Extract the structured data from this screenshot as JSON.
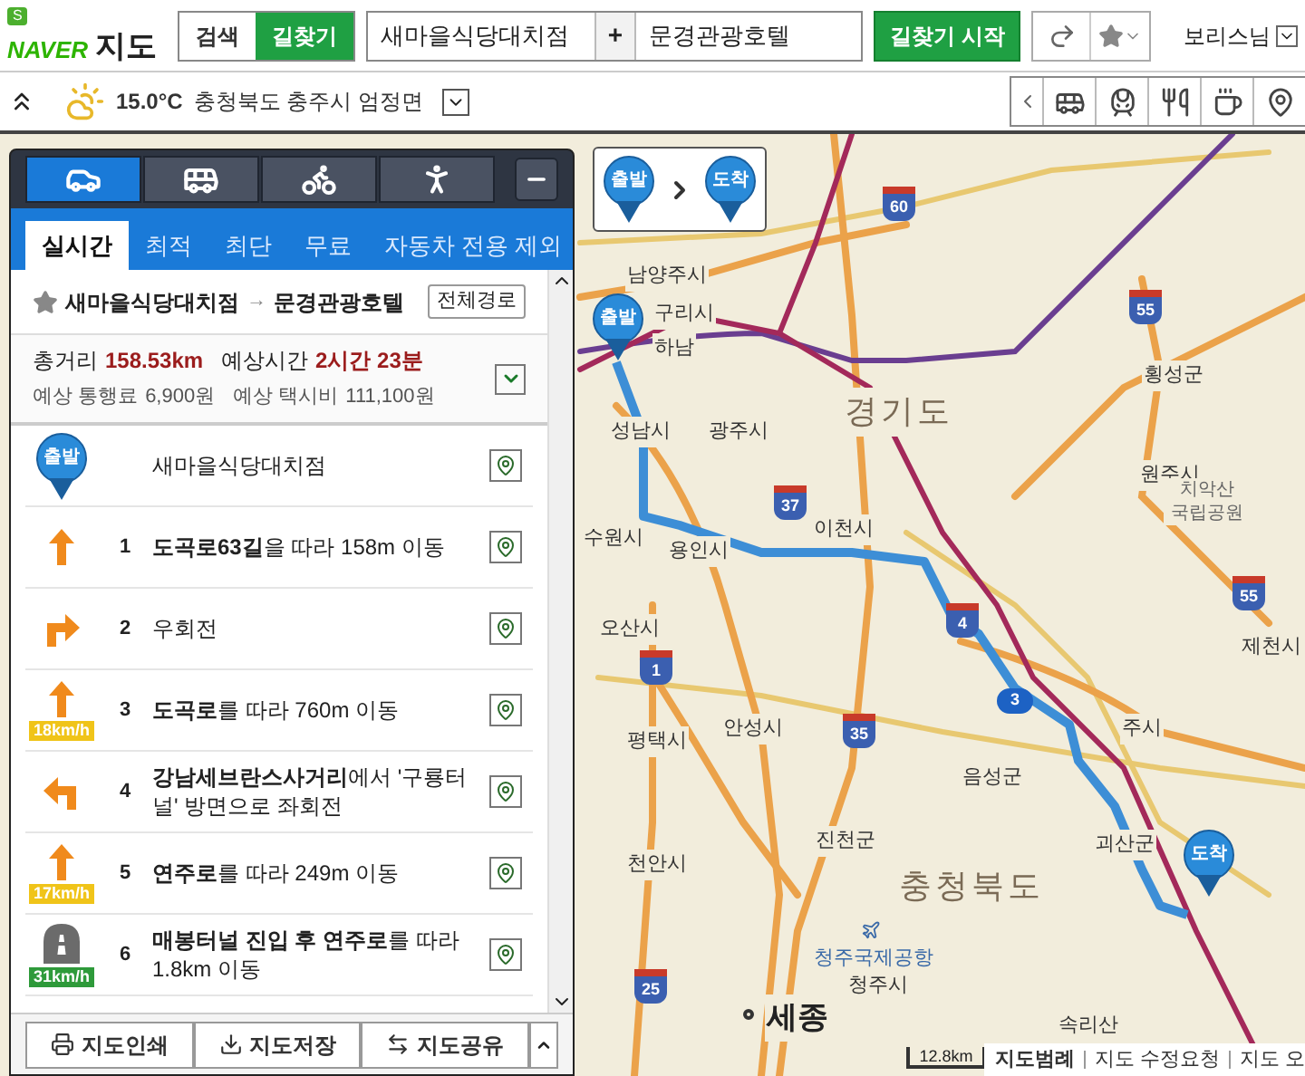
{
  "header": {
    "logo_badge": "S",
    "logo": "NAVER",
    "logo_suffix": "지도",
    "mode_buttons": [
      {
        "label": "검색",
        "selected": false
      },
      {
        "label": "길찾기",
        "selected": true
      }
    ],
    "origin": "새마을식당대치점",
    "add": "+",
    "destination": "문경관광호텔",
    "start_button": "길찾기 시작",
    "user": "보리스님"
  },
  "infobar": {
    "temperature": "15.0°C",
    "location": "충청북도 충주시 엄정면"
  },
  "panel": {
    "transport_tabs": [
      {
        "kind": "car",
        "selected": true
      },
      {
        "kind": "bus",
        "selected": false
      },
      {
        "kind": "bike",
        "selected": false
      },
      {
        "kind": "walk",
        "selected": false
      }
    ],
    "route_tabs": [
      {
        "label": "실시간",
        "selected": true
      },
      {
        "label": "최적",
        "selected": false
      },
      {
        "label": "최단",
        "selected": false
      },
      {
        "label": "무료",
        "selected": false
      },
      {
        "label": "자동차 전용 제외",
        "selected": false
      }
    ],
    "route_from": "새마을식당대치점",
    "route_arrow": "→",
    "route_to": "문경관광호텔",
    "full_route_button": "전체경로",
    "summary": {
      "distance_label": "총거리",
      "distance": "158.53km",
      "time_label": "예상시간",
      "time": "2시간 23분",
      "toll_label": "예상 통행료",
      "toll": "6,900원",
      "taxi_label": "예상 택시비",
      "taxi": "111,100원"
    },
    "steps": [
      {
        "kind": "start",
        "pin": "출발",
        "text": "새마을식당대치점"
      },
      {
        "kind": "straight",
        "number": "1",
        "text": "**도곡로63길**을 따라 158m 이동"
      },
      {
        "kind": "right",
        "number": "2",
        "text": "우회전"
      },
      {
        "kind": "straight",
        "number": "3",
        "text": "**도곡로**를 따라 760m 이동",
        "speed": "18km/h",
        "color": "#f0c419"
      },
      {
        "kind": "left",
        "number": "4",
        "text": "**강남세브란스사거리**에서 '구룡터널' 방면으로 좌회전"
      },
      {
        "kind": "straight",
        "number": "5",
        "text": "**연주로**를 따라 249m 이동",
        "speed": "17km/h",
        "color": "#f0c419"
      },
      {
        "kind": "tunnel",
        "number": "6",
        "text": "**매봉터널 진입 후 연주로**를 따라 1.8km 이동",
        "speed": "31km/h",
        "color": "#2e9a3a"
      }
    ],
    "footer_buttons": [
      {
        "kind": "print",
        "label": "지도인쇄"
      },
      {
        "kind": "save",
        "label": "지도저장"
      },
      {
        "kind": "share",
        "label": "지도공유"
      }
    ]
  },
  "map": {
    "legend": {
      "start": "출발",
      "end": "도착"
    },
    "start_pin": "출발",
    "end_pin": "도착",
    "labels": [
      {
        "text": "남양주시",
        "kind": "city"
      },
      {
        "text": "구리시",
        "kind": "city"
      },
      {
        "text": "하남",
        "kind": "city"
      },
      {
        "text": "성남시",
        "kind": "city"
      },
      {
        "text": "광주시",
        "kind": "city"
      },
      {
        "text": "경기도",
        "kind": "province"
      },
      {
        "text": "횡성군",
        "kind": "city"
      },
      {
        "text": "원주시",
        "kind": "city"
      },
      {
        "text": "치악산 국립공원",
        "kind": "park"
      },
      {
        "text": "수원시",
        "kind": "city"
      },
      {
        "text": "용인시",
        "kind": "city"
      },
      {
        "text": "이천시",
        "kind": "city"
      },
      {
        "text": "오산시",
        "kind": "city"
      },
      {
        "text": "제천시",
        "kind": "city"
      },
      {
        "text": "안성시",
        "kind": "city"
      },
      {
        "text": "평택시",
        "kind": "city"
      },
      {
        "text": "주시",
        "kind": "city"
      },
      {
        "text": "음성군",
        "kind": "city"
      },
      {
        "text": "진천군",
        "kind": "city"
      },
      {
        "text": "천안시",
        "kind": "city"
      },
      {
        "text": "괴산군",
        "kind": "city"
      },
      {
        "text": "충청북도",
        "kind": "province"
      },
      {
        "text": "청주국제공항",
        "kind": "airport"
      },
      {
        "text": "청주시",
        "kind": "city"
      },
      {
        "text": "세종",
        "kind": "capital"
      },
      {
        "text": "속리산",
        "kind": "city"
      }
    ],
    "shields": [
      {
        "text": "60",
        "kind": "expressway"
      },
      {
        "text": "55",
        "kind": "expressway"
      },
      {
        "text": "37",
        "kind": "expressway"
      },
      {
        "text": "55",
        "kind": "expressway"
      },
      {
        "text": "4",
        "kind": "expressway"
      },
      {
        "text": "1",
        "kind": "expressway"
      },
      {
        "text": "35",
        "kind": "expressway"
      },
      {
        "text": "3",
        "kind": "national"
      },
      {
        "text": "25",
        "kind": "expressway"
      }
    ],
    "scale": "12.8km",
    "footer_links": [
      "지도범례",
      "지도 수정요청",
      "지도 오"
    ]
  }
}
